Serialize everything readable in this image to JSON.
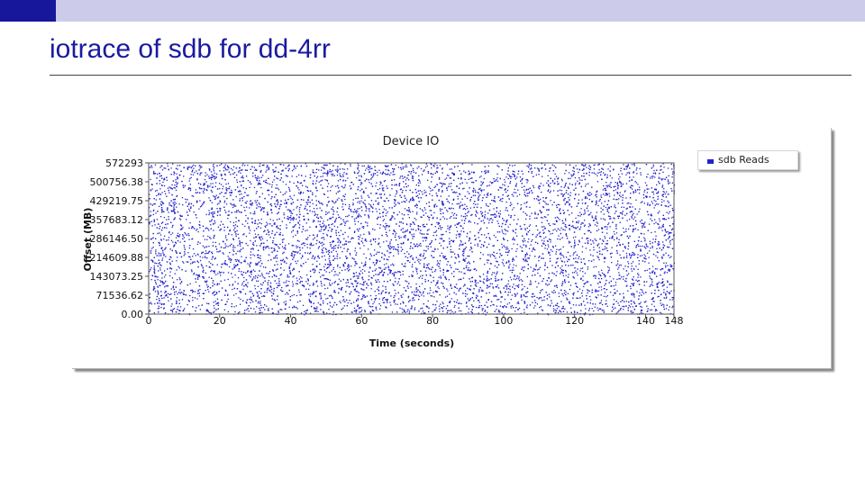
{
  "slide": {
    "title": "iotrace of sdb for dd-4rr"
  },
  "colors": {
    "title": "#1a1aa0",
    "topbar": "#ccccea",
    "topbar_accent": "#17179c",
    "series": "#2222cc"
  },
  "chart_data": {
    "type": "scatter",
    "title": "Device IO",
    "xlabel": "Time (seconds)",
    "ylabel": "Offset (MB)",
    "xlim": [
      0,
      148
    ],
    "ylim": [
      0,
      572293
    ],
    "x_ticks": [
      "0",
      "20",
      "40",
      "60",
      "80",
      "100",
      "120",
      "140",
      "148"
    ],
    "x_tick_values": [
      0,
      20,
      40,
      60,
      80,
      100,
      120,
      140,
      148
    ],
    "y_ticks": [
      "572293",
      "500756.38",
      "429219.75",
      "357683.12",
      "286146.50",
      "214609.88",
      "143073.25",
      "71536.62",
      "0.00"
    ],
    "y_tick_values": [
      572293,
      500756.38,
      429219.75,
      357683.12,
      286146.5,
      214609.88,
      143073.25,
      71536.62,
      0
    ],
    "legend_position": "top-right outside plot",
    "grid": false,
    "series": [
      {
        "name": "sdb Reads",
        "color": "#2222cc",
        "distribution": "uniform random reads across full offset range for the whole run",
        "x_range": [
          0,
          148
        ],
        "y_range": [
          0,
          572293
        ]
      }
    ]
  }
}
